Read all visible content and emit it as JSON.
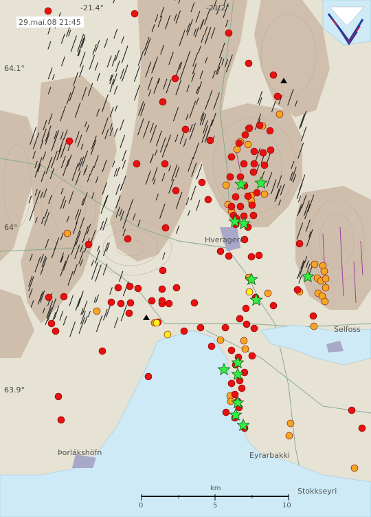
{
  "timestamp": "29.maí.08  21:45",
  "coords": {
    "top": [
      "-21.4°",
      "-21.2°"
    ],
    "left": [
      "64.1°",
      "64°",
      "63.9°"
    ]
  },
  "places": [
    "Hveragerði",
    "Selfoss",
    "Þorlákshöfn",
    "Eyrarbakki",
    "Stokkseyri"
  ],
  "scale": {
    "unit": "km",
    "ticks": [
      "0",
      "5",
      "10"
    ]
  },
  "legend_colors": {
    "red": "#e81010",
    "orange": "#f5a623",
    "yellow": "#ffee22",
    "star": "#33ee44",
    "water": "#cdeaf6",
    "land": "#e6e2d4",
    "terrain": "#cab6a2"
  },
  "icons": [
    "logo-icon",
    "earthquake-dot",
    "large-quake-star",
    "volcano-triangle"
  ]
}
